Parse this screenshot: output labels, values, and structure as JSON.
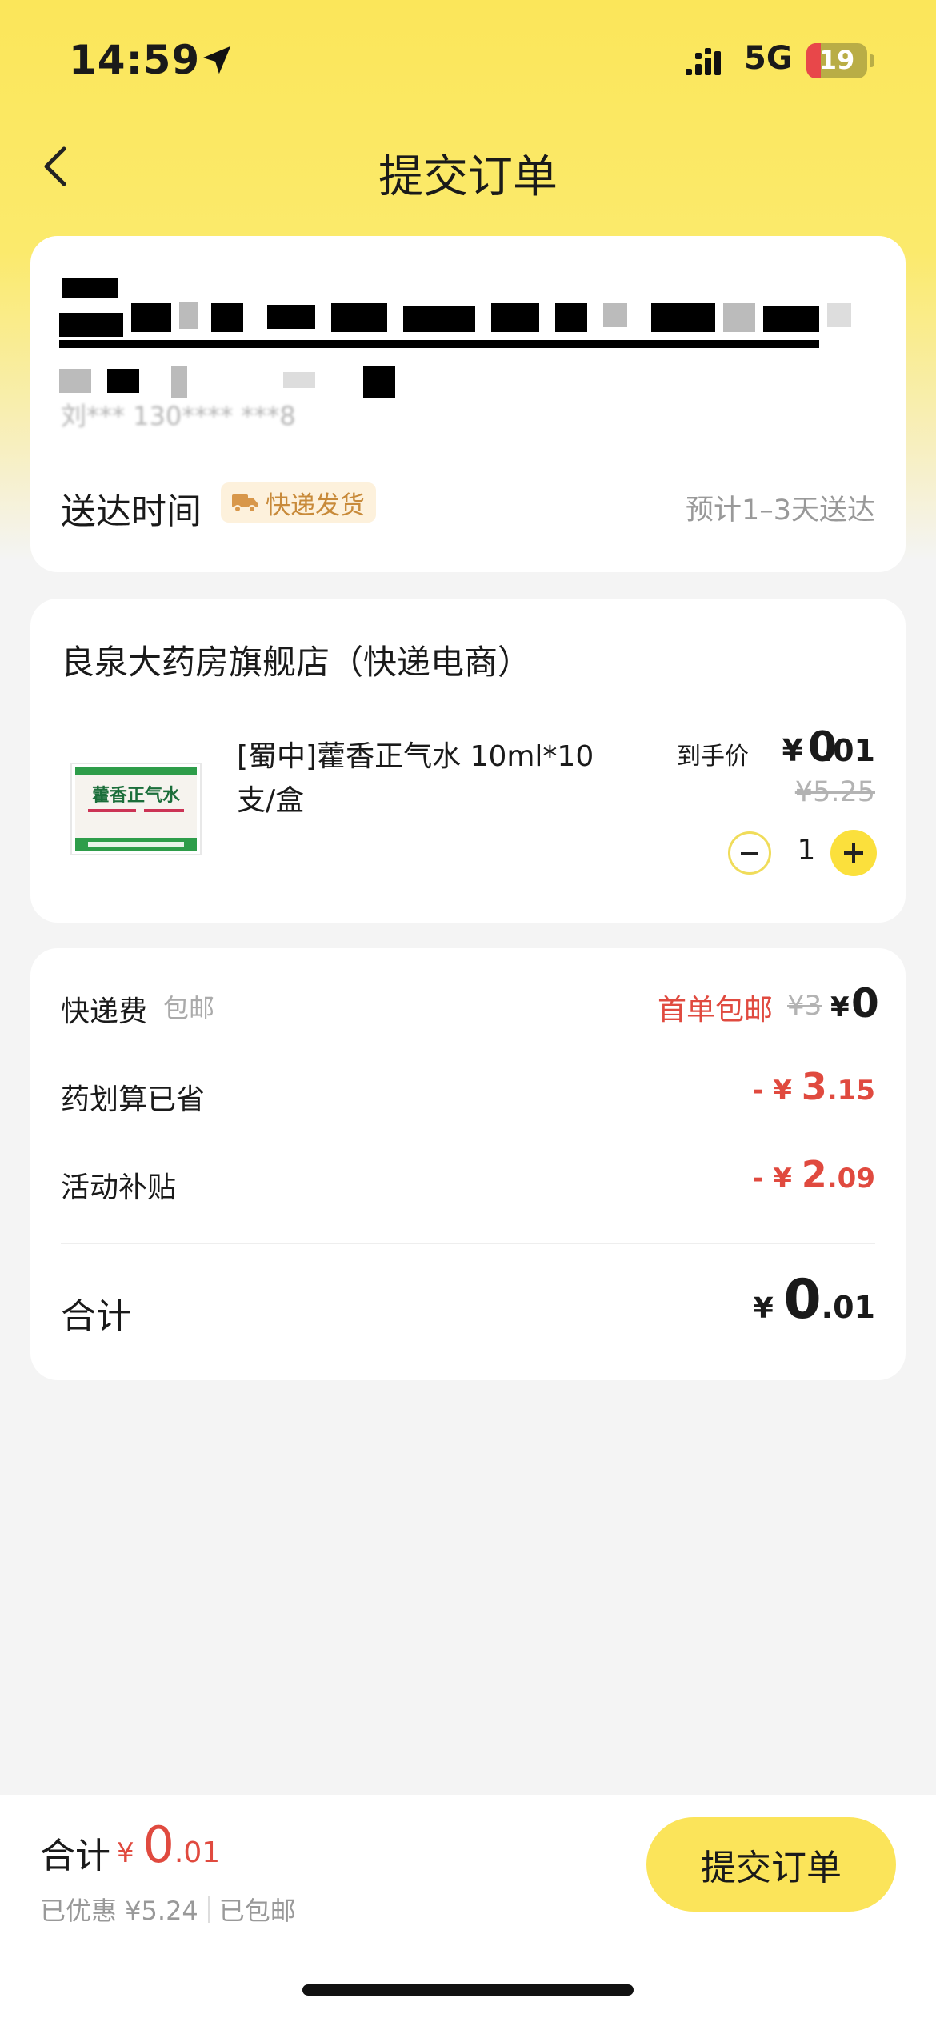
{
  "status_bar": {
    "time": "14:59",
    "network": "5G",
    "battery": "19"
  },
  "header": {
    "title": "提交订单"
  },
  "address": {
    "contact": "刘*** 130**** ***8",
    "delivery_label": "送达时间",
    "express_tag": "快递发货",
    "eta": "预计1–3天送达"
  },
  "store": {
    "name": "良泉大药房旗舰店（快递电商）",
    "product": {
      "name": "[蜀中]藿香正气水 10ml*10支/盒",
      "image_icon": "product-box-image",
      "price_label": "到手价",
      "price_yen": "¥",
      "price_int": "0",
      "price_dec": ".01",
      "original_price": "¥5.25",
      "quantity": "1"
    }
  },
  "fees": {
    "shipping_label": "快递费",
    "shipping_sub": "包邮",
    "first_free": "首单包邮",
    "shipping_orig": "¥3",
    "shipping_now_yen": "¥",
    "shipping_now": "0",
    "saved_label": "药划算已省",
    "saved_pre": "- ¥ ",
    "saved_int": "3",
    "saved_dec": ".15",
    "subsidy_label": "活动补贴",
    "subsidy_pre": "- ¥ ",
    "subsidy_int": "2",
    "subsidy_dec": ".09",
    "total_label": "合计",
    "total_yen": "¥ ",
    "total_int": "0",
    "total_dec": ".01"
  },
  "bottom_bar": {
    "label": "合计",
    "yen": "¥ ",
    "int": "0",
    "dec": ".01",
    "discount": "已优惠 ¥5.24",
    "shipping": "已包邮",
    "submit": "提交订单"
  },
  "colors": {
    "accent": "#fbe45a",
    "price_red": "#e04a3f",
    "background": "#f4f4f4"
  }
}
